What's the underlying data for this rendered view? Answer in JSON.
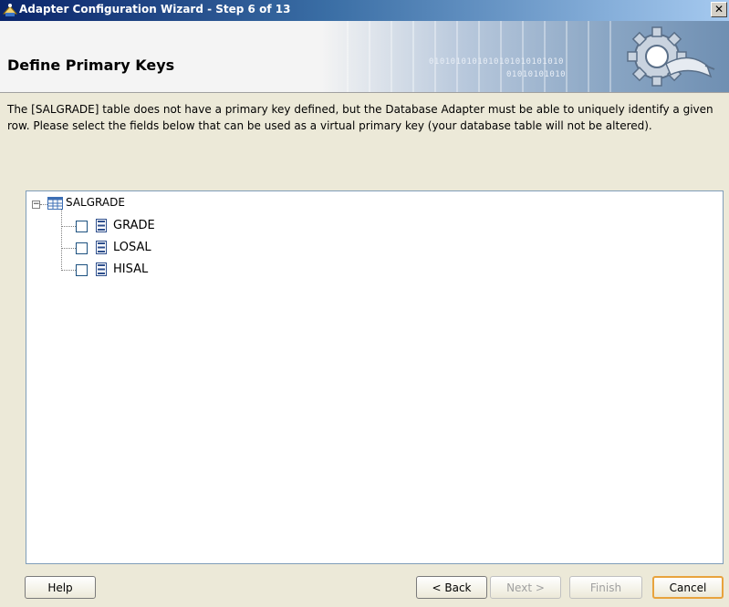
{
  "window": {
    "title": "Adapter Configuration Wizard - Step 6 of 13",
    "close_glyph": "✕"
  },
  "header": {
    "page_title": "Define Primary Keys",
    "binary_line1": "0101010101010101010101010",
    "binary_line2": "01010101010"
  },
  "description": "The [SALGRADE] table does not have a primary key defined, but the Database Adapter must be able to uniquely identify a given row.  Please select the fields below that can be used as a virtual primary key (your database table will not be altered).",
  "tree": {
    "root": {
      "label": "SALGRADE",
      "expanded": true,
      "icon": "table-icon"
    },
    "fields": [
      {
        "label": "GRADE",
        "checked": false,
        "icon": "column-icon"
      },
      {
        "label": "LOSAL",
        "checked": false,
        "icon": "column-icon"
      },
      {
        "label": "HISAL",
        "checked": false,
        "icon": "column-icon"
      }
    ]
  },
  "buttons": {
    "help": "Help",
    "back": "< Back",
    "next": "Next >",
    "finish": "Finish",
    "cancel": "Cancel"
  },
  "colors": {
    "titlebar_start": "#0a246a",
    "dialog_bg": "#ece9d8",
    "default_button_border": "#e8a33d"
  }
}
